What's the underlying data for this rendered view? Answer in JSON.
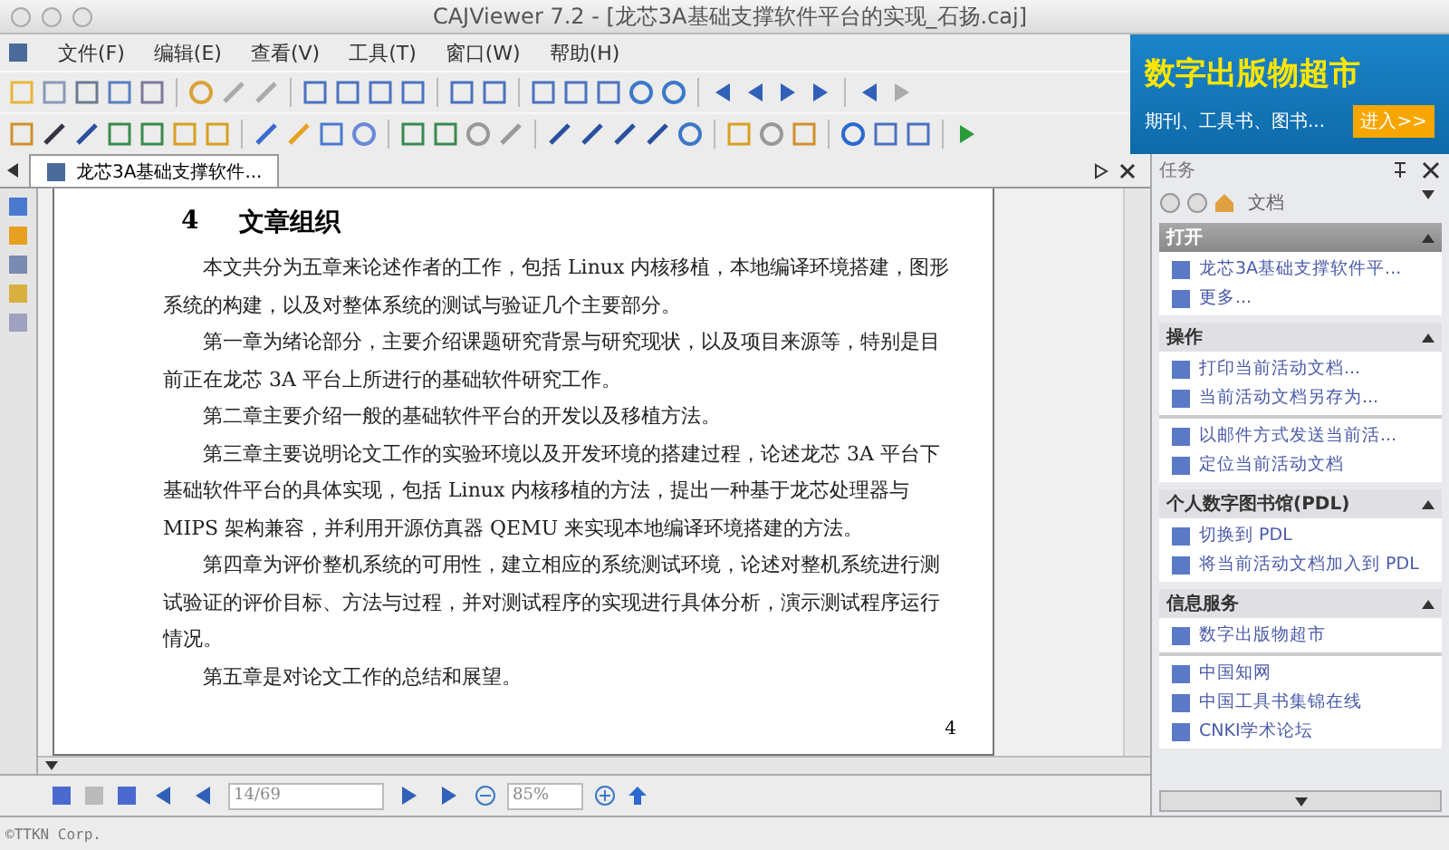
{
  "window": {
    "title": "CAJViewer 7.2 - [龙芯3A基础支撑软件平台的实现_石扬.caj]"
  },
  "menu": [
    {
      "label": "文件(F)"
    },
    {
      "label": "编辑(E)"
    },
    {
      "label": "查看(V)"
    },
    {
      "label": "工具(T)"
    },
    {
      "label": "窗口(W)"
    },
    {
      "label": "帮助(H)"
    }
  ],
  "ad": {
    "title": "数字出版物超市",
    "subtitle": "期刊、工具书、图书...",
    "button": "进入>>"
  },
  "tabs": [
    {
      "label": "龙芯3A基础支撑软件...",
      "selected": true
    }
  ],
  "document": {
    "heading_number": "4",
    "heading": "文章组织",
    "paragraphs": [
      "本文共分为五章来论述作者的工作，包括 Linux 内核移植，本地编译环境搭建，图形系统的构建，以及对整体系统的测试与验证几个主要部分。",
      "第一章为绪论部分，主要介绍课题研究背景与研究现状，以及项目来源等，特别是目前正在龙芯 3A 平台上所进行的基础软件研究工作。",
      "第二章主要介绍一般的基础软件平台的开发以及移植方法。",
      "第三章主要说明论文工作的实验环境以及开发环境的搭建过程，论述龙芯 3A 平台下基础软件平台的具体实现，包括 Linux 内核移植的方法，提出一种基于龙芯处理器与 MIPS 架构兼容，并利用开源仿真器 QEMU 来实现本地编译环境搭建的方法。",
      "第四章为评价整机系统的可用性，建立相应的系统测试环境，论述对整机系统进行测试验证的评价目标、方法与过程，并对测试程序的实现进行具体分析，演示测试程序运行情况。",
      "第五章是对论文工作的总结和展望。"
    ],
    "page_number": "4"
  },
  "task_panel": {
    "title": "任务",
    "view": "文档",
    "sections": [
      {
        "title": "打开",
        "selected": true,
        "expanded": true,
        "groups": [
          [
            "龙芯3A基础支撑软件平...",
            "更多..."
          ]
        ]
      },
      {
        "title": "操作",
        "selected": false,
        "expanded": true,
        "groups": [
          [
            "打印当前活动文档...",
            "当前活动文档另存为..."
          ],
          [
            "以邮件方式发送当前活...",
            "定位当前活动文档"
          ]
        ]
      },
      {
        "title": "个人数字图书馆(PDL)",
        "selected": false,
        "expanded": true,
        "groups": [
          [
            "切换到 PDL",
            "将当前活动文档加入到 PDL"
          ]
        ]
      },
      {
        "title": "信息服务",
        "selected": false,
        "expanded": true,
        "groups": [
          [
            "数字出版物超市"
          ],
          [
            "中国知网",
            "中国工具书集锦在线",
            "CNKI学术论坛"
          ]
        ]
      }
    ]
  },
  "page_nav": {
    "page": "14/69",
    "zoom": "85%"
  },
  "status_bar": "©TTKN Corp."
}
